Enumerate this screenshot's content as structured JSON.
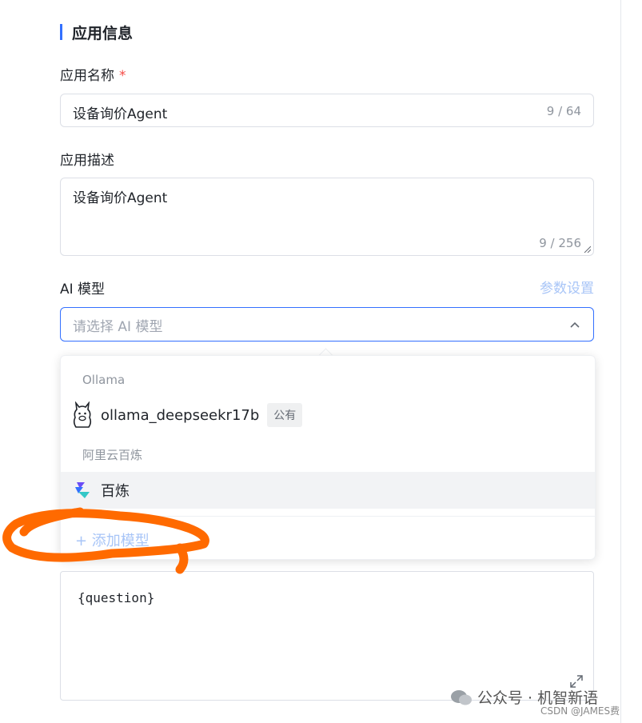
{
  "section": {
    "title": "应用信息"
  },
  "app_name": {
    "label": "应用名称",
    "required_mark": "*",
    "value": "设备询价Agent",
    "counter": "9 / 64"
  },
  "app_desc": {
    "label": "应用描述",
    "value": "设备询价Agent",
    "counter": "9 / 256"
  },
  "ai_model": {
    "label": "AI 模型",
    "param_link": "参数设置",
    "placeholder": "请选择 AI 模型",
    "chevron": "⌃"
  },
  "dropdown": {
    "groups": [
      {
        "label": "Ollama",
        "options": [
          {
            "label": "ollama_deepseekr17b",
            "tag": "公有",
            "icon": "llama-icon"
          }
        ]
      },
      {
        "label": "阿里云百炼",
        "options": [
          {
            "label": "百炼",
            "icon": "bailian-icon"
          }
        ]
      }
    ],
    "add_label": "+ 添加模型"
  },
  "prompt": {
    "value": "{question}"
  },
  "watermark": {
    "text": "公众号 · 机智新语",
    "sub": "CSDN @JAMES费"
  },
  "colors": {
    "accent": "#3370ff",
    "annotation": "#ff6a00"
  }
}
